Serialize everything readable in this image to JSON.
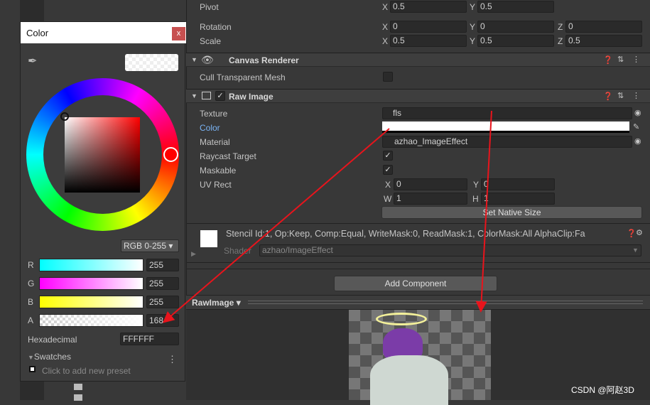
{
  "inspector": {
    "pivot": {
      "label": "Pivot",
      "x": "0.5",
      "y": "0.5"
    },
    "rotation": {
      "label": "Rotation",
      "x": "0",
      "y": "0",
      "z": "0"
    },
    "scale": {
      "label": "Scale",
      "x": "0.5",
      "y": "0.5",
      "z": "0.5"
    },
    "canvas_renderer": {
      "title": "Canvas Renderer",
      "cull_label": "Cull Transparent Mesh",
      "cull_checked": false
    },
    "raw_image": {
      "title": "Raw Image",
      "texture_label": "Texture",
      "texture_value": "fls",
      "color_label": "Color",
      "color_value": "#FFFFFF",
      "material_label": "Material",
      "material_value": "azhao_ImageEffect",
      "raycast_label": "Raycast Target",
      "maskable_label": "Maskable",
      "uvrect_label": "UV Rect",
      "uv": {
        "x": "0",
        "y": "0",
        "w": "1",
        "h": "1"
      },
      "set_native_size": "Set Native Size"
    },
    "material": {
      "info": "Stencil Id:1, Op:Keep, Comp:Equal, WriteMask:0, ReadMask:1, ColorMask:All AlphaClip:Fa",
      "shader_label": "Shader",
      "shader_value": "azhao/ImageEffect"
    },
    "add_component": "Add Component",
    "preview": {
      "title": "RawImage"
    }
  },
  "axes": {
    "x": "X",
    "y": "Y",
    "z": "Z",
    "w": "W",
    "h": "H"
  },
  "color_picker": {
    "title": "Color",
    "close": "x",
    "mode": "RGB 0-255",
    "channels": [
      {
        "label": "R",
        "value": "255"
      },
      {
        "label": "G",
        "value": "255"
      },
      {
        "label": "B",
        "value": "255"
      },
      {
        "label": "A",
        "value": "168"
      }
    ],
    "hex_label": "Hexadecimal",
    "hex_value": "FFFFFF",
    "swatches_label": "Swatches",
    "preset_hint": "Click to add new preset"
  },
  "watermark": "CSDN @阿赵3D",
  "colors": {
    "accent_label": "#7ab4f5",
    "arrow": "#e8141c",
    "close": "#c75050"
  }
}
